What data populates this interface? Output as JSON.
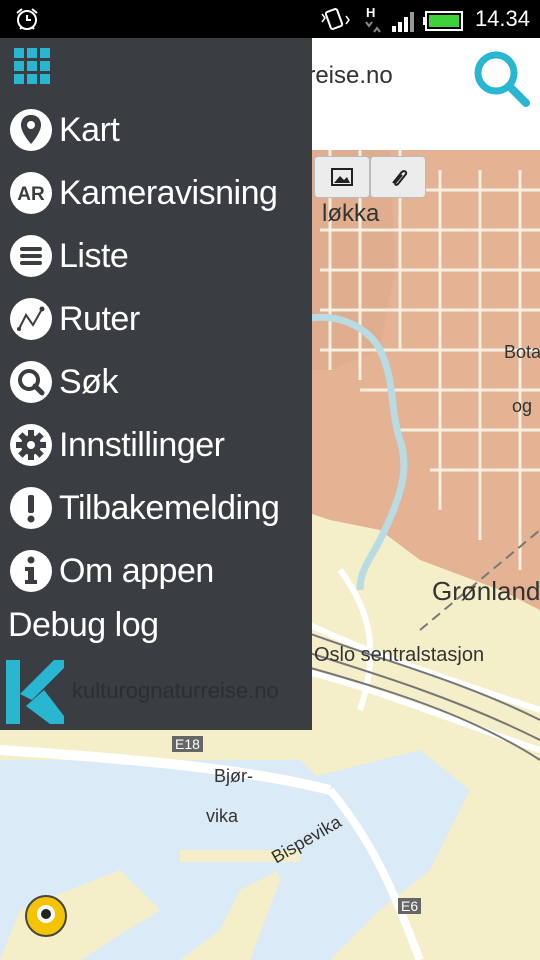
{
  "status_bar": {
    "time": "14.34",
    "network": "H"
  },
  "header": {
    "site_text": "urreise.no"
  },
  "map": {
    "labels": {
      "lokka": "løkka",
      "bota": "Bota",
      "og": "og",
      "gronland": "Grønland",
      "oslo_s": "Oslo sentralstasjon",
      "e18": "E18",
      "bjor": "Bjør-",
      "vika": "vika",
      "bispevika": "Bispevika",
      "e6": "E6"
    },
    "buttons": {
      "image_icon": "image-icon",
      "link_icon": "link-icon"
    }
  },
  "drawer": {
    "items": [
      {
        "label": "Kart",
        "icon": "map-pin-icon"
      },
      {
        "label": "Kameravisning",
        "icon": "ar-icon"
      },
      {
        "label": "Liste",
        "icon": "list-icon"
      },
      {
        "label": "Ruter",
        "icon": "route-icon"
      },
      {
        "label": "Søk",
        "icon": "search-icon"
      },
      {
        "label": "Innstillinger",
        "icon": "gear-icon"
      },
      {
        "label": "Tilbakemelding",
        "icon": "exclamation-icon"
      },
      {
        "label": "Om appen",
        "icon": "info-icon"
      }
    ],
    "ar_badge": "AR",
    "debug_label": "Debug log",
    "brand_text": "kulturognaturreise.no"
  },
  "colors": {
    "drawer_bg": "#3a3d42",
    "accent": "#29b6d1",
    "map_land": "#f4efc8",
    "map_urban": "#e3b393",
    "map_water": "#dbeaf7"
  }
}
